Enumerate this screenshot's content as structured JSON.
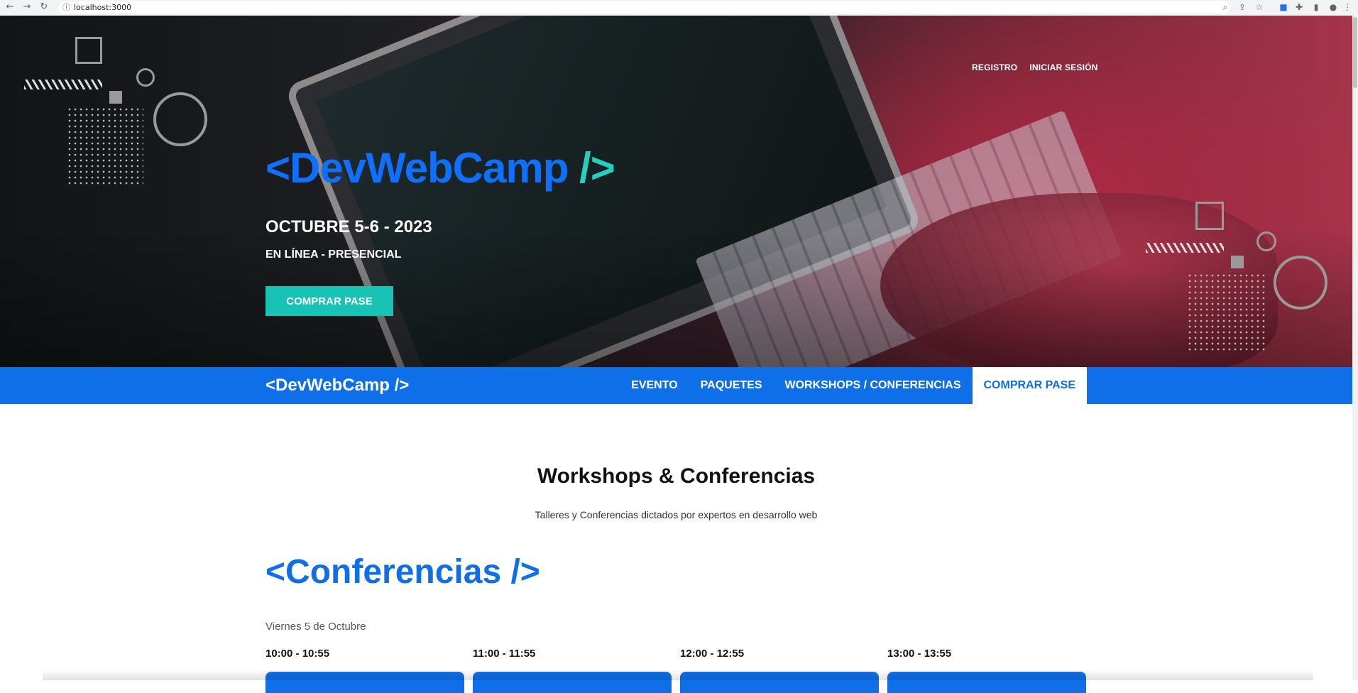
{
  "browser": {
    "url": "localhost:3000",
    "icons": [
      "back-icon",
      "forward-icon",
      "reload-icon",
      "info-icon",
      "zoom-icon",
      "share-icon",
      "star-icon",
      "extension-icon",
      "puzzle-icon",
      "sidepanel-icon",
      "profile-icon",
      "menu-icon"
    ]
  },
  "hero": {
    "links": [
      "REGISTRO",
      "INICIAR SESIÓN"
    ],
    "logo_open": "<DevWebCamp",
    "logo_close": " />",
    "date": "OCTUBRE 5-6 - 2023",
    "mode": "EN LÍNEA - PRESENCIAL",
    "cta": "COMPRAR PASE"
  },
  "navbar": {
    "logo": "<DevWebCamp />",
    "items": [
      "EVENTO",
      "PAQUETES",
      "WORKSHOPS / CONFERENCIAS",
      "COMPRAR PASE"
    ],
    "active_index": 3
  },
  "main": {
    "title": "Workshops & Conferencias",
    "subtitle": "Talleres y Conferencias dictados por expertos en desarrollo web",
    "conferences_heading": "<Conferencias />",
    "day": "Viernes 5 de Octubre",
    "slots": [
      "10:00 - 10:55",
      "11:00 - 11:55",
      "12:00 - 12:55",
      "13:00 - 13:55"
    ]
  },
  "colors": {
    "primary": "#0f6fe8",
    "accent": "#18c3b6",
    "hero_dark": "#121417",
    "hero_red": "#a8344a"
  }
}
